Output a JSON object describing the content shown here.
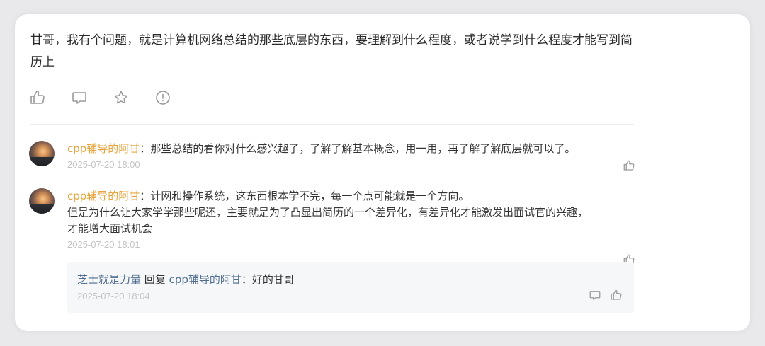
{
  "question": {
    "text": "甘哥，我有个问题，就是计算机网络总结的那些底层的东西，要理解到什么程度，或者说学到什么程度才能写到简历上"
  },
  "actions": [
    {
      "icon": "thumbs-up-icon"
    },
    {
      "icon": "comment-icon"
    },
    {
      "icon": "star-icon"
    },
    {
      "icon": "report-icon"
    }
  ],
  "comments": [
    {
      "author": "cpp辅导的阿甘",
      "separator": "：",
      "text": "那些总结的看你对什么感兴趣了，了解了解基本概念，用一用，再了解了解底层就可以了。",
      "time": "2025-07-20 18:00"
    },
    {
      "author": "cpp辅导的阿甘",
      "separator": "：",
      "text_line1": "计网和操作系统，这东西根本学不完，每一个点可能就是一个方向。",
      "text_line2": "但是为什么让大家学学那些呢还，主要就是为了凸显出简历的一个差异化，有差异化才能激发出面试官的兴趣，",
      "text_line3": "才能增大面试机会",
      "time": "2025-07-20 18:01"
    }
  ],
  "reply": {
    "from": "芝士就是力量",
    "reply_word": "回复",
    "to": "cpp辅导的阿甘",
    "separator": "：",
    "text": "好的甘哥",
    "time": "2025-07-20 18:04"
  },
  "colors": {
    "author": "#e8a53e",
    "reply_user": "#4f6d8f",
    "icon": "#9a9a9a",
    "time": "#c4c4c4"
  }
}
